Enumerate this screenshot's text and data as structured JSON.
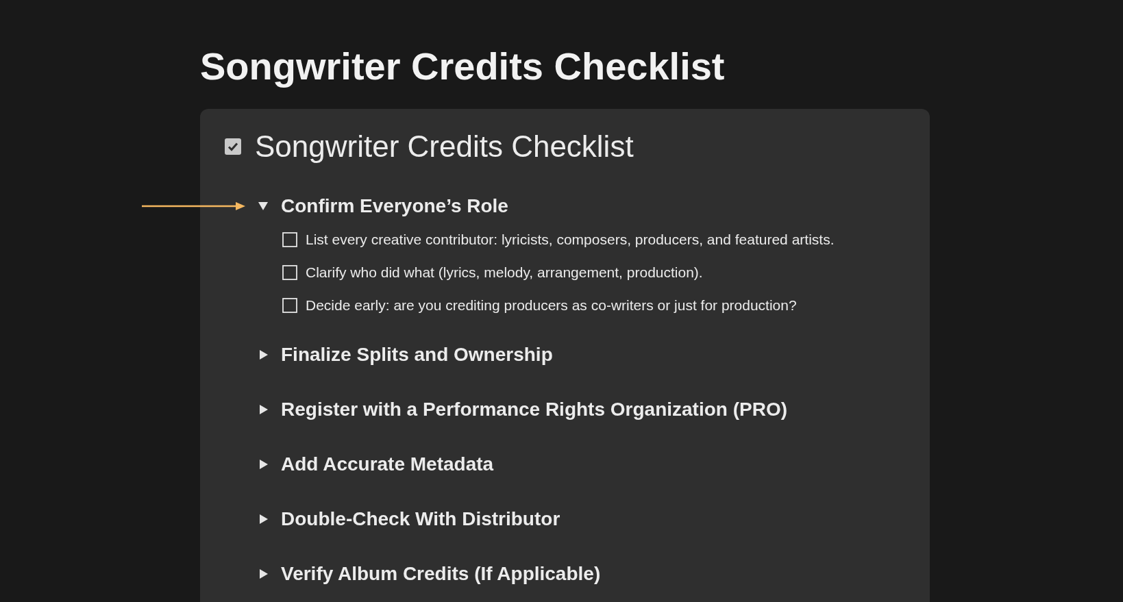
{
  "page_title": "Songwriter Credits Checklist",
  "card": {
    "title": "Songwriter Credits Checklist",
    "checked": true
  },
  "sections": [
    {
      "title": "Confirm Everyone’s Role",
      "expanded": true,
      "items": [
        {
          "text": "List every creative contributor: lyricists, composers, producers, and featured artists.",
          "checked": false
        },
        {
          "text": "Clarify who did what (lyrics, melody, arrangement, production).",
          "checked": false
        },
        {
          "text": "Decide early: are you crediting producers as co-writers or just for production?",
          "checked": false
        }
      ]
    },
    {
      "title": "Finalize Splits and Ownership",
      "expanded": false
    },
    {
      "title": "Register with a Performance Rights Organization (PRO)",
      "expanded": false
    },
    {
      "title": "Add Accurate Metadata",
      "expanded": false
    },
    {
      "title": "Double-Check With Distributor",
      "expanded": false
    },
    {
      "title": "Verify Album Credits (If Applicable)",
      "expanded": false
    }
  ]
}
